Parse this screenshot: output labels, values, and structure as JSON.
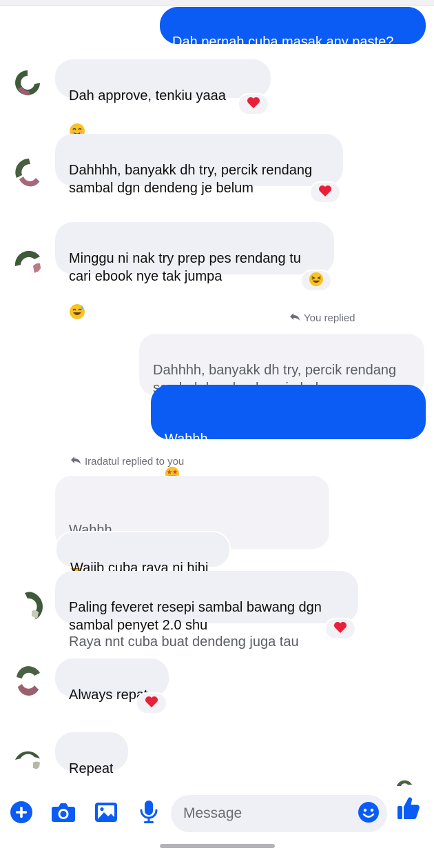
{
  "thread": {
    "messages": [
      {
        "id": "m1",
        "direction": "outgoing",
        "text": "Dah pernah cuba masak any paste?"
      },
      {
        "id": "m2",
        "direction": "incoming",
        "text": "Dah approve, tenkiu yaaa",
        "emoji": "smiling-face-icon",
        "reaction": "heart-icon"
      },
      {
        "id": "m3",
        "direction": "incoming",
        "text": "Dahhhh, banyakk dh try, percik rendang\nsambal dgn dendeng je belum",
        "reaction": "heart-icon"
      },
      {
        "id": "m4",
        "direction": "incoming",
        "text": "Minggu ni nak try prep pes rendang tu\ncari ebook nye tak jumpa",
        "emoji": "grinning-sweat-icon",
        "reaction": "laughing-face-icon"
      },
      {
        "id": "m5",
        "direction": "outgoing",
        "reply_note": "You replied",
        "quoted_text": "Dahhhh, banyakk dh try, percik rendang\nsambal dgn dendeng je belum",
        "line1": "Wahhh",
        "line1_emojis": [
          "star-struck-icon",
          "star-struck-icon"
        ],
        "line2": "Raya nnt cuba buat dendeng juga tau"
      },
      {
        "id": "m6",
        "direction": "incoming",
        "reply_note": "Iradatul replied to you",
        "quoted_line1": "Wahhh",
        "quoted_line2": "Raya nnt cuba buat dendeng juga tau",
        "text": "Wajib cuba raya ni hihi"
      },
      {
        "id": "m7",
        "direction": "incoming",
        "text": "Paling feveret resepi sambal bawang dgn\nsambal penyet 2.0 shu",
        "reaction": "heart-icon"
      },
      {
        "id": "m8",
        "direction": "incoming",
        "text": "Always repat",
        "reaction": "heart-icon"
      },
      {
        "id": "m9",
        "direction": "incoming",
        "text": "Repeat"
      }
    ]
  },
  "composer": {
    "placeholder": "Message",
    "buttons": [
      "plus-icon",
      "camera-icon",
      "image-icon",
      "microphone-icon",
      "emoji-icon",
      "thumbs-up-icon"
    ]
  },
  "colors": {
    "accent": "#0a5cf5",
    "incoming_bubble": "#eff0f5",
    "heart": "#e8203a",
    "emoji_yellow": "#f7c325"
  }
}
